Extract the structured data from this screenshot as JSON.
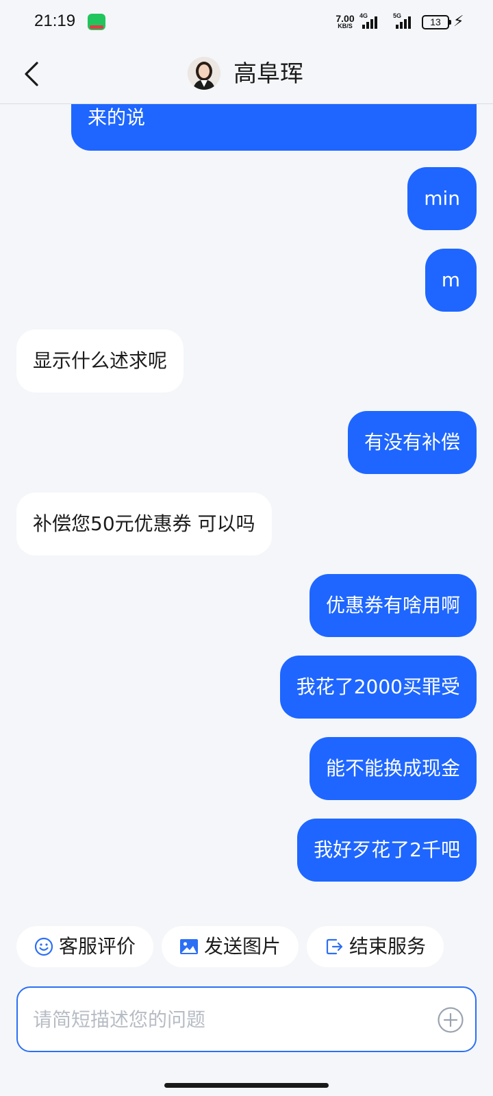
{
  "status_bar": {
    "time": "21:19",
    "net_speed_value": "7.00",
    "net_speed_unit": "KB/S",
    "network_1": "4G",
    "network_2": "5G",
    "battery": "13"
  },
  "header": {
    "title": "高阜珲"
  },
  "messages": [
    {
      "from": "me",
      "text": "来的说"
    },
    {
      "from": "me",
      "text": "min"
    },
    {
      "from": "me",
      "text": "m"
    },
    {
      "from": "them",
      "text": "显示什么述求呢"
    },
    {
      "from": "me",
      "text": "有没有补偿"
    },
    {
      "from": "them",
      "text": "补偿您50元优惠券 可以吗"
    },
    {
      "from": "me",
      "text": "优惠券有啥用啊"
    },
    {
      "from": "me",
      "text": "我花了2000买罪受"
    },
    {
      "from": "me",
      "text": "能不能换成现金"
    },
    {
      "from": "me",
      "text": "我好歹花了2千吧"
    }
  ],
  "quick_actions": {
    "rate_service": "客服评价",
    "send_image": "发送图片",
    "end_service": "结束服务"
  },
  "input": {
    "placeholder": "请简短描述您的问题",
    "value": ""
  },
  "colors": {
    "accent": "#1e66ff",
    "background": "#f4f6f9",
    "incoming_bubble": "#ffffff"
  },
  "icons": {
    "back": "chevron-left-icon",
    "rate_service": "smile-icon",
    "send_image": "image-icon",
    "end_service": "exit-icon",
    "add": "plus-circle-icon",
    "app": "app-notification-icon",
    "charging": "lightning-icon"
  }
}
